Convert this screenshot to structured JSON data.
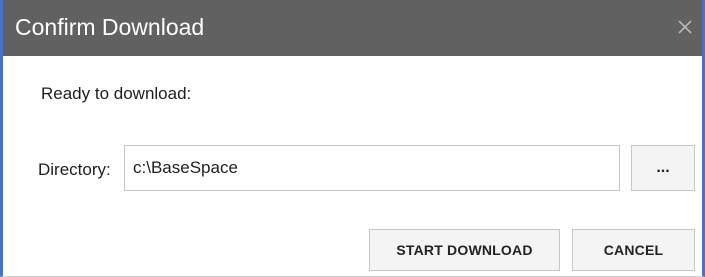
{
  "dialog": {
    "title": "Confirm Download",
    "close_icon": "close-icon",
    "message": "Ready to download:",
    "directory": {
      "label": "Directory:",
      "value": "c:\\BaseSpace",
      "browse_label": "..."
    },
    "buttons": {
      "start_label": "START DOWNLOAD",
      "cancel_label": "CANCEL"
    }
  },
  "colors": {
    "titlebar_bg": "#616161",
    "window_border": "#4a72c4",
    "button_bg": "#f4f4f4"
  }
}
